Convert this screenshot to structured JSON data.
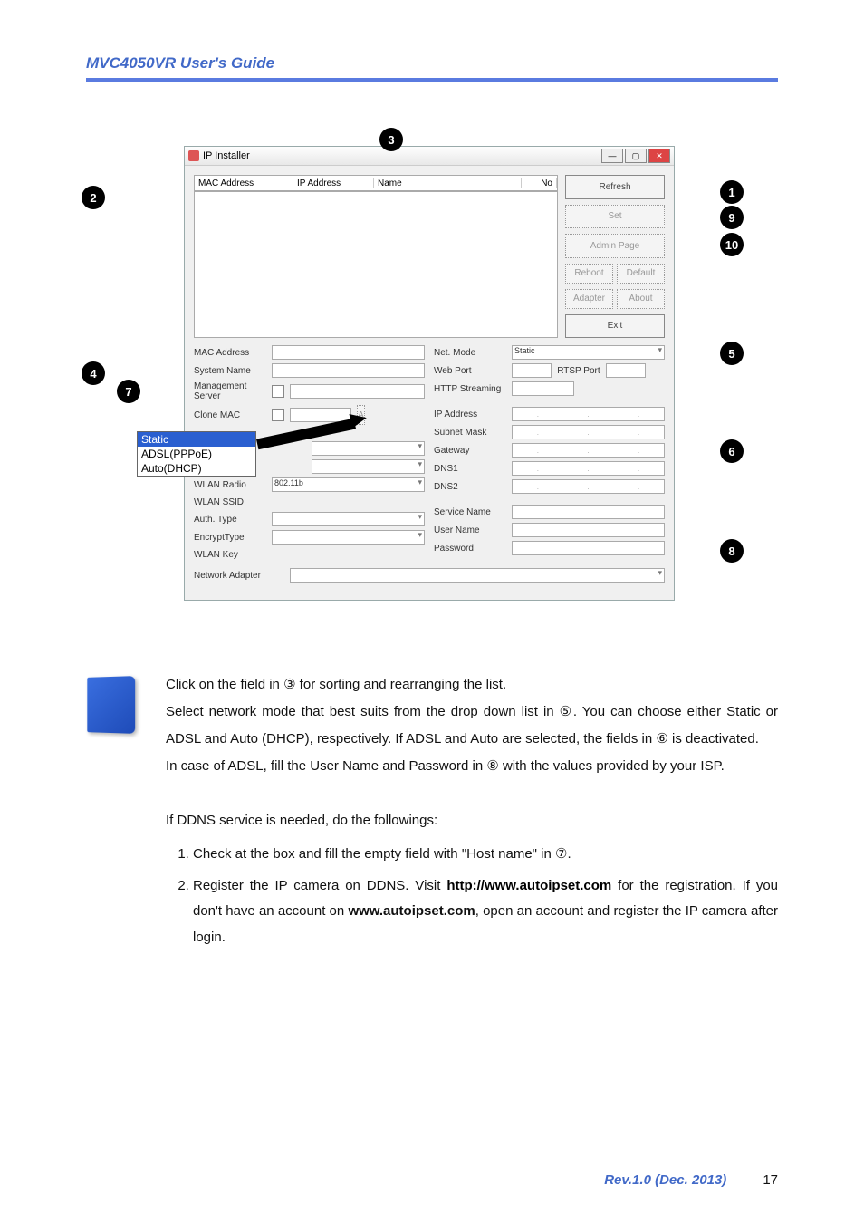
{
  "header": {
    "title": "MVC4050VR User's Guide"
  },
  "window": {
    "title": "IP Installer",
    "columns": {
      "mac": "MAC Address",
      "ip": "IP Address",
      "name": "Name",
      "no": "No"
    },
    "buttons": {
      "refresh": "Refresh",
      "set": "Set",
      "admin": "Admin Page",
      "reboot": "Reboot",
      "default": "Default",
      "adapter": "Adapter",
      "about": "About",
      "exit": "Exit"
    },
    "labels": {
      "mac_address": "MAC Address",
      "system_name": "System Name",
      "management_server": "Management Server",
      "clone_mac": "Clone MAC",
      "wlan_radio": "WLAN Radio",
      "wlan_radio_val": "802.11b",
      "wlan_ssid": "WLAN SSID",
      "auth_type": "Auth. Type",
      "encrypt_type": "EncryptType",
      "wlan_key": "WLAN Key",
      "network_adapter": "Network Adapter",
      "net_mode": "Net. Mode",
      "net_mode_val": "Static",
      "web_port": "Web Port",
      "rtsp_port": "RTSP Port",
      "http_streaming": "HTTP Streaming",
      "ip_address": "IP Address",
      "subnet_mask": "Subnet Mask",
      "gateway": "Gateway",
      "dns1": "DNS1",
      "dns2": "DNS2",
      "service_name": "Service Name",
      "user_name": "User Name",
      "password": "Password"
    }
  },
  "dropdown": {
    "opt1": "Static",
    "opt2": "ADSL(PPPoE)",
    "opt3": "Auto(DHCP)"
  },
  "callouts": {
    "c1": "1",
    "c2": "2",
    "c3": "3",
    "c4": "4",
    "c5": "5",
    "c6": "6",
    "c7": "7",
    "c8": "8",
    "c9": "9",
    "c10": "10"
  },
  "instructions": {
    "p1": "Click on the field in ③ for sorting and rearranging the list.",
    "p2a": "Select network mode that best suits from the drop down list in ⑤. You can choose either Static or ADSL and Auto (DHCP), respectively. If ADSL and Auto are selected, the fields in ⑥ is deactivated.",
    "p3": "In case of ADSL, fill the User Name and Password in ⑧ with the values provided by your ISP.",
    "p4": "If DDNS service is needed, do the followings:",
    "step1": "Check at the box and fill the empty field with \"Host name\" in ⑦.",
    "step2a": "Register the IP camera on DDNS. Visit ",
    "step2link": "http://www.autoipset.com",
    "step2b": " for the registration. If you don't have an account on ",
    "step2bold": "www.autoipset.com",
    "step2c": ", open an account and register the IP camera after login."
  },
  "footer": {
    "rev": "Rev.1.0 (Dec. 2013)",
    "page": "17"
  }
}
